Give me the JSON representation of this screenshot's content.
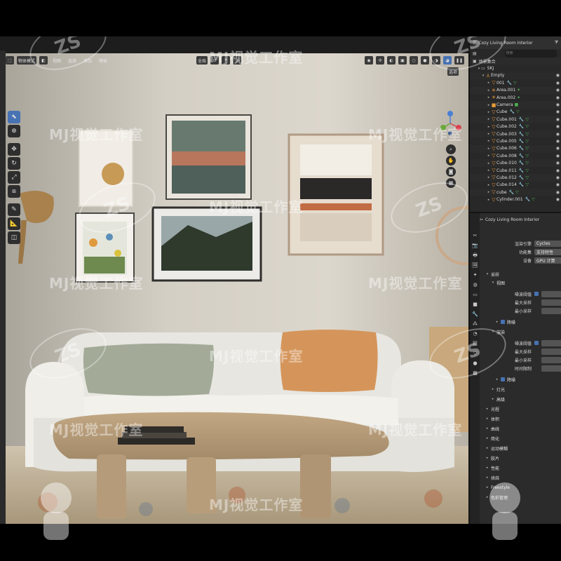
{
  "viewport": {
    "header": {
      "mode_label": "物体模式",
      "menu": [
        "视图",
        "选择",
        "添加",
        "物体"
      ],
      "orientation_label": "全局",
      "options_label": "选项"
    },
    "tools": [
      "select",
      "cursor",
      "move",
      "rotate",
      "scale",
      "transform",
      "annotate",
      "measure",
      "add-cube"
    ]
  },
  "outliner": {
    "title": "Cozy Living Room Interior",
    "search_placeholder": "搜索",
    "scene_collection": "场景集合",
    "collection": "SKJ",
    "items": [
      {
        "name": "Empty",
        "type": "empty"
      },
      {
        "name": "001",
        "type": "mesh"
      },
      {
        "name": "Area.001",
        "type": "light"
      },
      {
        "name": "Area.002",
        "type": "light"
      },
      {
        "name": "Camera",
        "type": "camera"
      },
      {
        "name": "Cube",
        "type": "mesh"
      },
      {
        "name": "Cube.001",
        "type": "mesh"
      },
      {
        "name": "Cube.002",
        "type": "mesh"
      },
      {
        "name": "Cube.003",
        "type": "mesh"
      },
      {
        "name": "Cube.005",
        "type": "mesh"
      },
      {
        "name": "Cube.006",
        "type": "mesh"
      },
      {
        "name": "Cube.008",
        "type": "mesh"
      },
      {
        "name": "Cube.010",
        "type": "mesh"
      },
      {
        "name": "Cube.011",
        "type": "mesh"
      },
      {
        "name": "Cube.012",
        "type": "mesh"
      },
      {
        "name": "Cube.014",
        "type": "mesh"
      },
      {
        "name": "cube",
        "type": "mesh"
      },
      {
        "name": "Cylinder.001",
        "type": "mesh"
      }
    ]
  },
  "properties": {
    "scene_name": "Cozy Living Room Interior",
    "render_engine_label": "渲染引擎",
    "render_engine_value": "Cycles",
    "feature_set_label": "功能集",
    "feature_set_value": "支持特性",
    "device_label": "设备",
    "device_value": "GPU 计算",
    "sampling_label": "采样",
    "viewport_label": "视图",
    "noise_threshold_label": "噪波阈值",
    "max_samples_label": "最大采样",
    "min_samples_label": "最小采样",
    "denoise_label": "降噪",
    "render_label": "渲染",
    "time_limit_label": "时间限制",
    "sections": [
      "灯光",
      "高级",
      "光程",
      "体积",
      "曲线",
      "简化",
      "运动模糊",
      "胶片",
      "性能",
      "烘焙",
      "Freestyle",
      "色彩管理"
    ]
  },
  "watermark": {
    "text": "MJ视觉工作室",
    "logo": "ZS"
  },
  "colors": {
    "accent": "#4772b3",
    "panel": "#2b2b2b",
    "object_icon": "#e79b3a",
    "material_icon": "#4caf50",
    "wall": "#d7d2c8",
    "sofa": "#ecebe6",
    "table": "#b79b78"
  }
}
